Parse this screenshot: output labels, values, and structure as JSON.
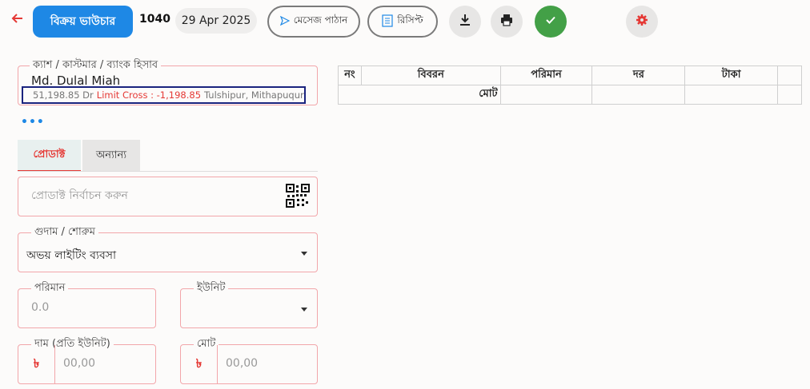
{
  "header": {
    "title": "বিক্রয় ভাউচার",
    "voucher_no": "1040",
    "date": "29 Apr 2025",
    "send_message_label": "মেসেজ পাঠান",
    "receipt_label": "রিসিপ্ট"
  },
  "colors": {
    "primary": "#1e88e5",
    "danger": "#e53935",
    "success": "#43a047",
    "border": "#f2a6aa"
  },
  "icons": [
    "back-arrow-icon",
    "send-icon",
    "document-icon",
    "download-icon",
    "print-icon",
    "check-icon",
    "gear-icon",
    "qr-code-icon",
    "more-dots-icon",
    "chevron-down-icon"
  ],
  "party": {
    "legend": "ক্যাশ / কাস্টমার / ব্যাংক হিসাব",
    "name": "Md. Dulal Miah",
    "balance": "51,198.85 Dr",
    "limit_text": "Limit Cross : -1,198.85",
    "address": "Tulshipur, Mithapuqur,"
  },
  "more_dots": "•••",
  "tabs": [
    {
      "label": "প্রোডাক্ট"
    },
    {
      "label": "অন্যান্য"
    }
  ],
  "product": {
    "placeholder": "প্রোডাক্ট নির্বাচন করুন"
  },
  "godown": {
    "legend": "গুদাম / শোরুম",
    "value": "অভয় লাইটিং ব্যবসা"
  },
  "quantity": {
    "legend": "পরিমান",
    "placeholder": "0.0"
  },
  "unit": {
    "legend": "ইউনিট",
    "value": ""
  },
  "price": {
    "legend": "দাম (প্রতি ইউনিট)",
    "currency": "৳",
    "placeholder": "00,00"
  },
  "total": {
    "legend": "মোট",
    "currency": "৳",
    "placeholder": "00,00"
  },
  "table": {
    "headers": [
      "নং",
      "বিবরন",
      "পরিমান",
      "দর",
      "টাকা",
      ""
    ],
    "total_label": "মোট"
  }
}
